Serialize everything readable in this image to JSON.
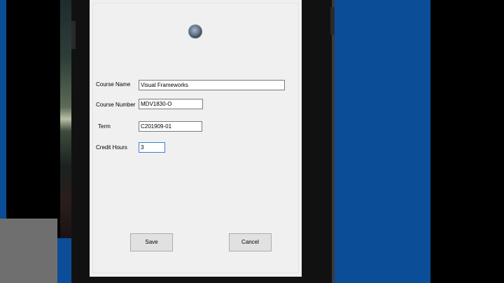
{
  "form": {
    "fields": [
      {
        "label": "Course Name",
        "value": "Visual Frameworks"
      },
      {
        "label": "Course Number",
        "value": "MDV1830-O"
      },
      {
        "label": "Term",
        "value": "C201909-01"
      },
      {
        "label": "Credit Hours",
        "value": "3"
      }
    ],
    "buttons": {
      "save": "Save",
      "cancel": "Cancel"
    }
  },
  "icons": {
    "avatar": "profile-avatar-icon"
  },
  "colors": {
    "form_background": "#f0f0f0",
    "desktop_blue": "#0b4d97",
    "focus_border": "#3c7fd1"
  }
}
